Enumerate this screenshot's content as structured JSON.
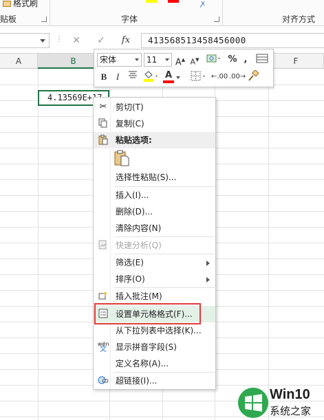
{
  "ribbon": {
    "format_painter_label": "格式刷",
    "clipboard_group": "贴板",
    "font_group": "字体",
    "alignment_group": "对齐方式"
  },
  "formula_bar": {
    "cancel_symbol": "✕",
    "enter_symbol": "✓",
    "fx_label": "fx",
    "content": "413568513458456000"
  },
  "columns": [
    "A",
    "B",
    "",
    "",
    "",
    "F"
  ],
  "active_cell": {
    "display": "4.13569E+17"
  },
  "mini_toolbar": {
    "font_name": "宋体",
    "font_size": "11",
    "grow_font": "A",
    "shrink_font": "A",
    "bold": "B",
    "italic": "I",
    "font_color_letter": "A",
    "percent": "%",
    "comma": ",",
    "increase_decimal": "←.00",
    "decrease_decimal": ".00→"
  },
  "context_menu": {
    "cut": "剪切(T)",
    "copy": "复制(C)",
    "paste_options": "粘贴选项:",
    "paste_special": "选择性粘贴(S)...",
    "insert": "插入(I)...",
    "delete": "删除(D)...",
    "clear_contents": "清除内容(N)",
    "quick_analysis": "快速分析(Q)",
    "filter": "筛选(E)",
    "sort": "排序(O)",
    "insert_comment": "插入批注(M)",
    "format_cells": "设置单元格格式(F)...",
    "pick_from_list": "从下拉列表中选择(K)...",
    "show_phonetic": "显示拼音字段(S)",
    "define_name": "定义名称(A)...",
    "hyperlink": "超链接(I)..."
  },
  "watermark": {
    "line1": "Win10",
    "line2": "系统之家"
  },
  "colors": {
    "excel_green": "#217346",
    "highlight_red": "#e03b3b",
    "menu_hover": "#e4f1e7"
  }
}
